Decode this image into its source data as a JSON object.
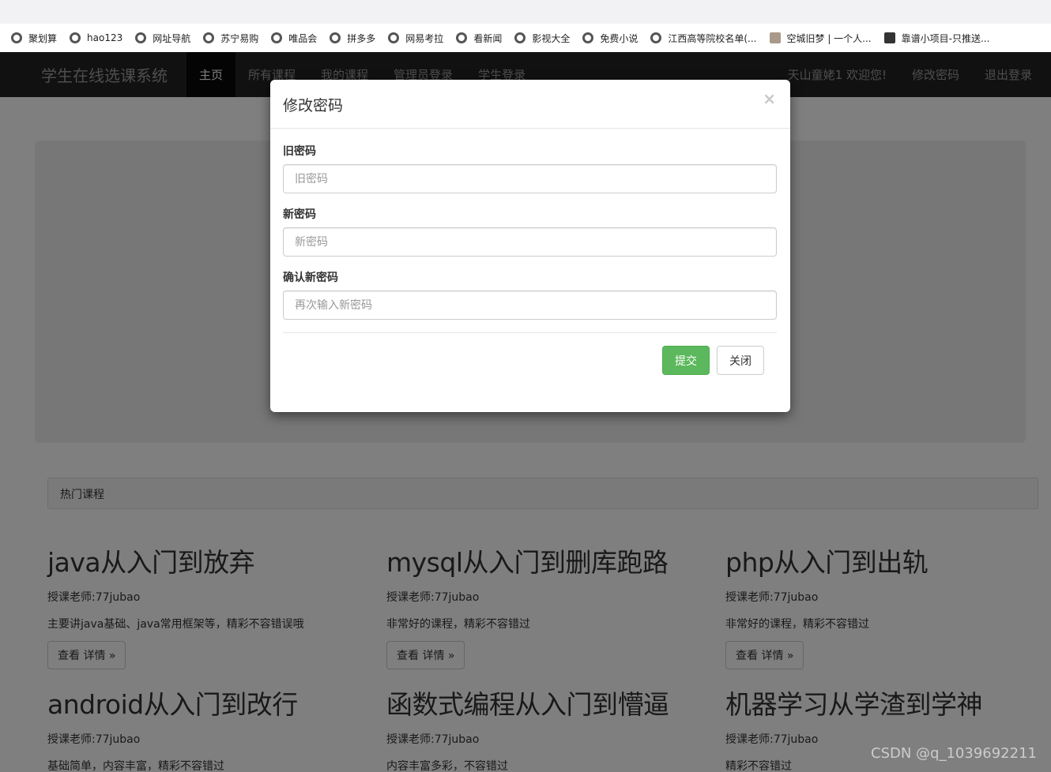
{
  "bookmarks": [
    {
      "label": "聚划算",
      "icon": "globe-icon"
    },
    {
      "label": "hao123",
      "icon": "globe-icon"
    },
    {
      "label": "网址导航",
      "icon": "globe-icon"
    },
    {
      "label": "苏宁易购",
      "icon": "globe-icon"
    },
    {
      "label": "唯品会",
      "icon": "globe-icon"
    },
    {
      "label": "拼多多",
      "icon": "globe-icon"
    },
    {
      "label": "网易考拉",
      "icon": "globe-icon"
    },
    {
      "label": "看新闻",
      "icon": "globe-icon"
    },
    {
      "label": "影视大全",
      "icon": "globe-icon"
    },
    {
      "label": "免费小说",
      "icon": "globe-icon"
    },
    {
      "label": "江西高等院校名单(...",
      "icon": "globe-icon"
    },
    {
      "label": "空城旧梦 | 一个人...",
      "icon": "avatar-icon"
    },
    {
      "label": "靠谱小项目-只推送...",
      "icon": "x-icon"
    }
  ],
  "navbar": {
    "brand": "学生在线选课系统",
    "items": [
      "主页",
      "所有课程",
      "我的课程",
      "管理员登录",
      "学生登录"
    ],
    "right_items": [
      "天山童姥1 欢迎您!",
      "修改密码",
      "退出登录"
    ]
  },
  "panel": {
    "heading": "热门课程"
  },
  "courses": [
    {
      "title": "java从入门到放弃",
      "teacher": "授课老师:77jubao",
      "desc": "主要讲java基础、java常用框架等，精彩不容错误哦",
      "button": "查看 详情 »"
    },
    {
      "title": "mysql从入门到删库跑路",
      "teacher": "授课老师:77jubao",
      "desc": "非常好的课程，精彩不容错过",
      "button": "查看 详情 »"
    },
    {
      "title": "php从入门到出轨",
      "teacher": "授课老师:77jubao",
      "desc": "非常好的课程，精彩不容错过",
      "button": "查看 详情 »"
    },
    {
      "title": "android从入门到改行",
      "teacher": "授课老师:77jubao",
      "desc": "基础简单，内容丰富，精彩不容错过"
    },
    {
      "title": "函数式编程从入门到懵逼",
      "teacher": "授课老师:77jubao",
      "desc": "内容丰富多彩，不容错过"
    },
    {
      "title": "机器学习从学渣到学神",
      "teacher": "授课老师:77jubao",
      "desc": "精彩不容错过"
    }
  ],
  "modal": {
    "title": "修改密码",
    "close_symbol": "×",
    "fields": [
      {
        "label": "旧密码",
        "placeholder": "旧密码",
        "value": ""
      },
      {
        "label": "新密码",
        "placeholder": "新密码",
        "value": ""
      },
      {
        "label": "确认新密码",
        "placeholder": "再次输入新密码",
        "value": ""
      }
    ],
    "submit_label": "提交",
    "close_label": "关闭"
  },
  "watermark": "CSDN @q_1039692211",
  "colors": {
    "navbar_bg": "#222222",
    "submit_green": "#5cb85c",
    "backdrop": "rgba(0,0,0,0.5)"
  }
}
